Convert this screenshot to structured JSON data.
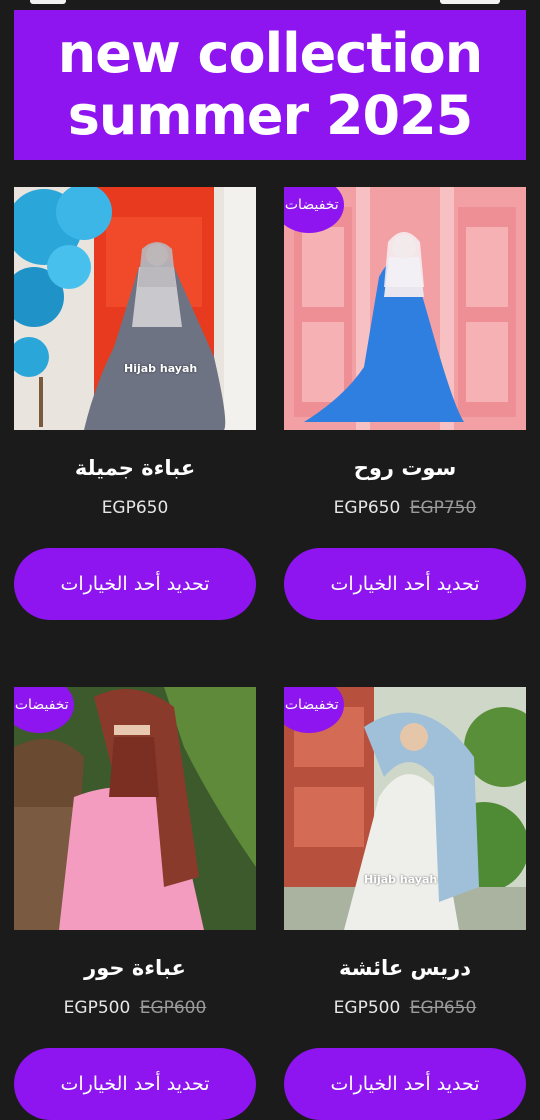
{
  "banner": {
    "line1": "new collection",
    "line2": "summer 2025"
  },
  "colors": {
    "accent": "#8e14f0",
    "background": "#1b1b1b"
  },
  "products": [
    {
      "name": "سوت روح",
      "price": "EGP650",
      "old_price": "EGP750",
      "badge": "تخفيضات!",
      "button": "تحديد أحد الخيارات",
      "watermark": ""
    },
    {
      "name": "عباءة جميلة",
      "price": "EGP650",
      "old_price": "",
      "badge": "",
      "button": "تحديد أحد الخيارات",
      "watermark": "Hijab hayah"
    },
    {
      "name": "دريس عائشة",
      "price": "EGP500",
      "old_price": "EGP650",
      "badge": "تخفيضات!",
      "button": "تحديد أحد الخيارات",
      "watermark": "Hijab hayah"
    },
    {
      "name": "عباءة حور",
      "price": "EGP500",
      "old_price": "EGP600",
      "badge": "تخفيضات!",
      "button": "تحديد أحد الخيارات",
      "watermark": ""
    }
  ]
}
